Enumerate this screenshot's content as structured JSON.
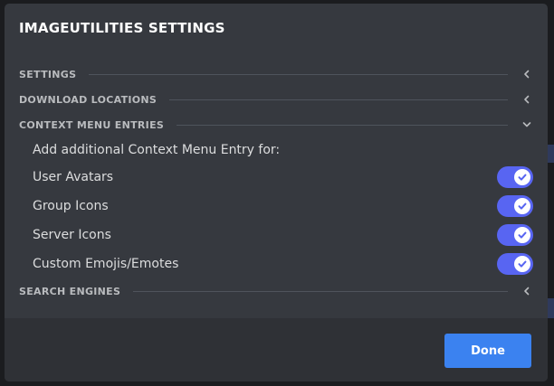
{
  "modal": {
    "title": "IMAGEUTILITIES SETTINGS"
  },
  "sections": [
    {
      "label": "SETTINGS",
      "state": "collapsed",
      "icon": "chevron-left-icon"
    },
    {
      "label": "DOWNLOAD LOCATIONS",
      "state": "collapsed",
      "icon": "chevron-left-icon"
    },
    {
      "label": "CONTEXT MENU ENTRIES",
      "state": "expanded",
      "icon": "chevron-down-icon"
    },
    {
      "label": "SEARCH ENGINES",
      "state": "collapsed",
      "icon": "chevron-left-icon"
    }
  ],
  "context_menu": {
    "intro": "Add additional Context Menu Entry for:",
    "toggles": [
      {
        "label": "User Avatars",
        "enabled": true
      },
      {
        "label": "Group Icons",
        "enabled": true
      },
      {
        "label": "Server Icons",
        "enabled": true
      },
      {
        "label": "Custom Emojis/Emotes",
        "enabled": true
      }
    ]
  },
  "footer": {
    "done_label": "Done"
  },
  "colors": {
    "modal_bg": "#36393f",
    "footer_bg": "#2f3136",
    "toggle_on": "#5865f2",
    "button_bg": "#3b82f0"
  }
}
